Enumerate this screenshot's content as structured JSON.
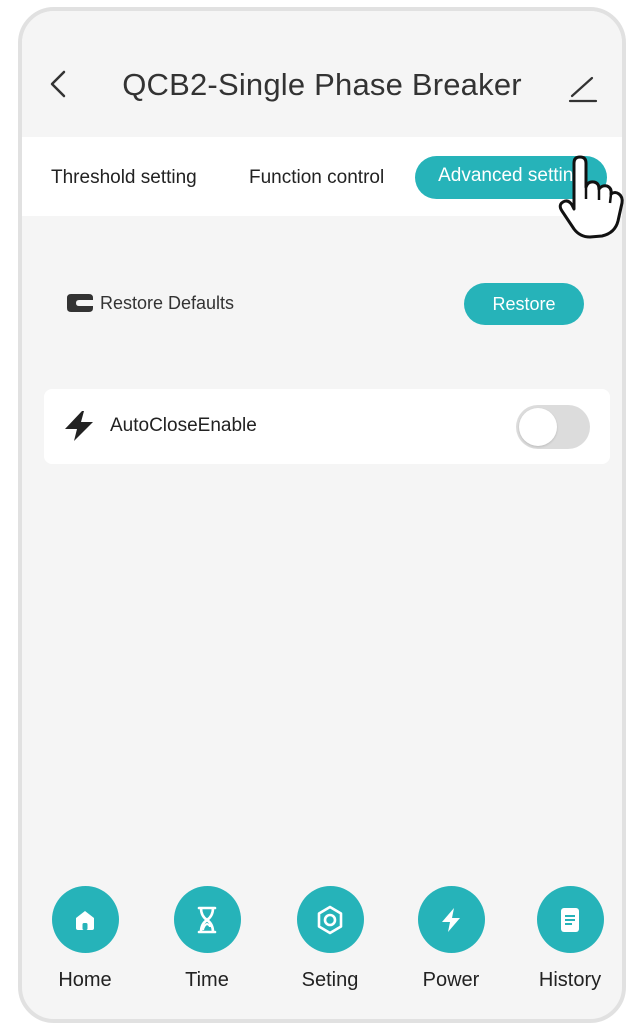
{
  "header": {
    "title": "QCB2-Single Phase Breaker"
  },
  "tabs": [
    {
      "label": "Threshold setting"
    },
    {
      "label": "Function control"
    },
    {
      "label": "Advanced setting"
    }
  ],
  "restore": {
    "label": "Restore Defaults",
    "button": "Restore"
  },
  "auto_close": {
    "label": "AutoCloseEnable",
    "enabled": false
  },
  "nav": [
    {
      "label": "Home",
      "icon": "home-icon"
    },
    {
      "label": "Time",
      "icon": "hourglass-icon"
    },
    {
      "label": "Seting",
      "icon": "hexagon-nut-icon"
    },
    {
      "label": "Power",
      "icon": "bolt-icon"
    },
    {
      "label": "History",
      "icon": "document-icon"
    }
  ],
  "colors": {
    "accent": "#26b3b9",
    "background": "#f5f5f5",
    "text": "#222222"
  }
}
